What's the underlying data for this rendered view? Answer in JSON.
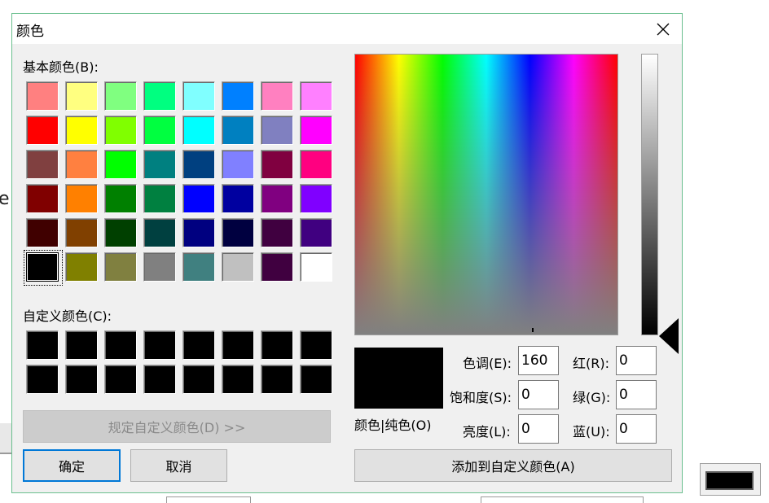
{
  "background": {
    "partial_letter": "e"
  },
  "dialog": {
    "title": "颜色",
    "basic_colors_label": "基本颜色(B):",
    "custom_colors_label": "自定义颜色(C):",
    "define_custom_button": "规定自定义颜色(D) >>",
    "ok_button": "确定",
    "cancel_button": "取消",
    "add_custom_button": "添加到自定义颜色(A)",
    "color_solid_label": "颜色|纯色(O)",
    "fields": {
      "hue": {
        "label": "色调(E):",
        "value": "160"
      },
      "sat": {
        "label": "饱和度(S):",
        "value": "0"
      },
      "lum": {
        "label": "亮度(L):",
        "value": "0"
      },
      "red": {
        "label": "红(R):",
        "value": "0"
      },
      "green": {
        "label": "绿(G):",
        "value": "0"
      },
      "blue": {
        "label": "蓝(U):",
        "value": "0"
      }
    },
    "current_color": "#000000",
    "selected_basic_index": 40,
    "basic_colors": [
      "#ff8080",
      "#ffff80",
      "#80ff80",
      "#00ff80",
      "#80ffff",
      "#0080ff",
      "#ff80c0",
      "#ff80ff",
      "#ff0000",
      "#ffff00",
      "#80ff00",
      "#00ff40",
      "#00ffff",
      "#0080c0",
      "#8080c0",
      "#ff00ff",
      "#804040",
      "#ff8040",
      "#00ff00",
      "#008080",
      "#004080",
      "#8080ff",
      "#800040",
      "#ff0080",
      "#800000",
      "#ff8000",
      "#008000",
      "#008040",
      "#0000ff",
      "#0000a0",
      "#800080",
      "#8000ff",
      "#400000",
      "#804000",
      "#004000",
      "#004040",
      "#000080",
      "#000040",
      "#400040",
      "#400080",
      "#000000",
      "#808000",
      "#808040",
      "#808080",
      "#408080",
      "#c0c0c0",
      "#400040",
      "#ffffff"
    ],
    "custom_colors": [
      "#000000",
      "#000000",
      "#000000",
      "#000000",
      "#000000",
      "#000000",
      "#000000",
      "#000000",
      "#000000",
      "#000000",
      "#000000",
      "#000000",
      "#000000",
      "#000000",
      "#000000",
      "#000000"
    ]
  }
}
